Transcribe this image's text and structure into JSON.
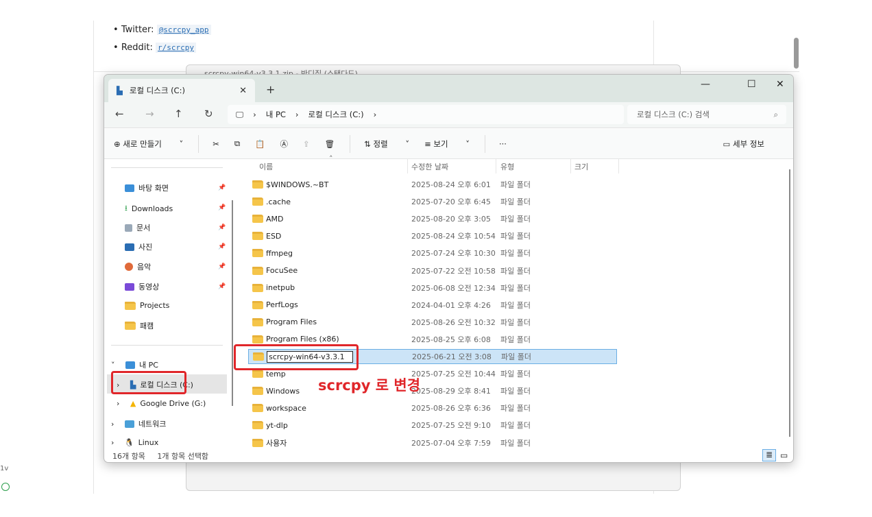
{
  "doc": {
    "bullets": [
      {
        "label": "Twitter:",
        "link": "@scrcpy_app"
      },
      {
        "label": "Reddit:",
        "link": "r/scrcpy"
      }
    ],
    "side_text": "1v"
  },
  "bg_window": {
    "title": "scrcpy-win64-v3.3.1.zip - 반디집 (스탠다드)"
  },
  "explorer": {
    "tab_title": "로컬 디스크 (C:)",
    "breadcrumb": [
      "내 PC",
      "로컬 디스크 (C:)"
    ],
    "search_placeholder": "로컬 디스크 (C:) 검색",
    "toolbar": {
      "new": "새로 만들기",
      "sort": "정렬",
      "view": "보기",
      "more": "···",
      "details": "세부 정보"
    },
    "sidebar": {
      "quick": [
        {
          "label": "바탕 화면",
          "icon": "desktop-icon"
        },
        {
          "label": "Downloads",
          "icon": "download-icon"
        },
        {
          "label": "문서",
          "icon": "document-icon"
        },
        {
          "label": "사진",
          "icon": "pictures-icon"
        },
        {
          "label": "음악",
          "icon": "music-icon"
        },
        {
          "label": "동영상",
          "icon": "video-icon"
        },
        {
          "label": "Projects",
          "icon": "folder-icon"
        },
        {
          "label": "패캠",
          "icon": "folder-icon"
        }
      ],
      "tree": [
        {
          "label": "내 PC"
        },
        {
          "label": "로컬 디스크 (C:)"
        },
        {
          "label": "Google Drive (G:)"
        },
        {
          "label": "네트워크"
        },
        {
          "label": "Linux"
        }
      ]
    },
    "columns": [
      "이름",
      "수정한 날짜",
      "유형",
      "크기"
    ],
    "files": [
      {
        "name": "$WINDOWS.~BT",
        "date": "2025-08-24 오후 6:01",
        "type": "파일 폴더"
      },
      {
        "name": ".cache",
        "date": "2025-07-20 오후 6:45",
        "type": "파일 폴더"
      },
      {
        "name": "AMD",
        "date": "2025-08-20 오후 3:05",
        "type": "파일 폴더"
      },
      {
        "name": "ESD",
        "date": "2025-08-24 오후 10:54",
        "type": "파일 폴더"
      },
      {
        "name": "ffmpeg",
        "date": "2025-07-24 오후 10:30",
        "type": "파일 폴더"
      },
      {
        "name": "FocuSee",
        "date": "2025-07-22 오전 10:58",
        "type": "파일 폴더"
      },
      {
        "name": "inetpub",
        "date": "2025-06-08 오전 12:34",
        "type": "파일 폴더"
      },
      {
        "name": "PerfLogs",
        "date": "2024-04-01 오후 4:26",
        "type": "파일 폴더"
      },
      {
        "name": "Program Files",
        "date": "2025-08-26 오전 10:32",
        "type": "파일 폴더"
      },
      {
        "name": "Program Files (x86)",
        "date": "2025-08-25 오후 6:08",
        "type": "파일 폴더"
      },
      {
        "name": "scrcpy-win64-v3.3.1",
        "date": "2025-06-21 오전 3:08",
        "type": "파일 폴더",
        "selected": true,
        "renaming": true
      },
      {
        "name": "temp",
        "date": "2025-07-25 오전 10:44",
        "type": "파일 폴더"
      },
      {
        "name": "Windows",
        "date": "2025-08-29 오후 8:41",
        "type": "파일 폴더"
      },
      {
        "name": "workspace",
        "date": "2025-08-26 오후 6:36",
        "type": "파일 폴더"
      },
      {
        "name": "yt-dlp",
        "date": "2025-07-25 오전 9:10",
        "type": "파일 폴더"
      },
      {
        "name": "사용자",
        "date": "2025-07-04 오후 7:59",
        "type": "파일 폴더"
      }
    ],
    "status": {
      "count": "16개 항목",
      "selected": "1개 항목 선택함"
    }
  },
  "annotation": {
    "text": "scrcpy 로 변경",
    "color": "#e0262a"
  }
}
